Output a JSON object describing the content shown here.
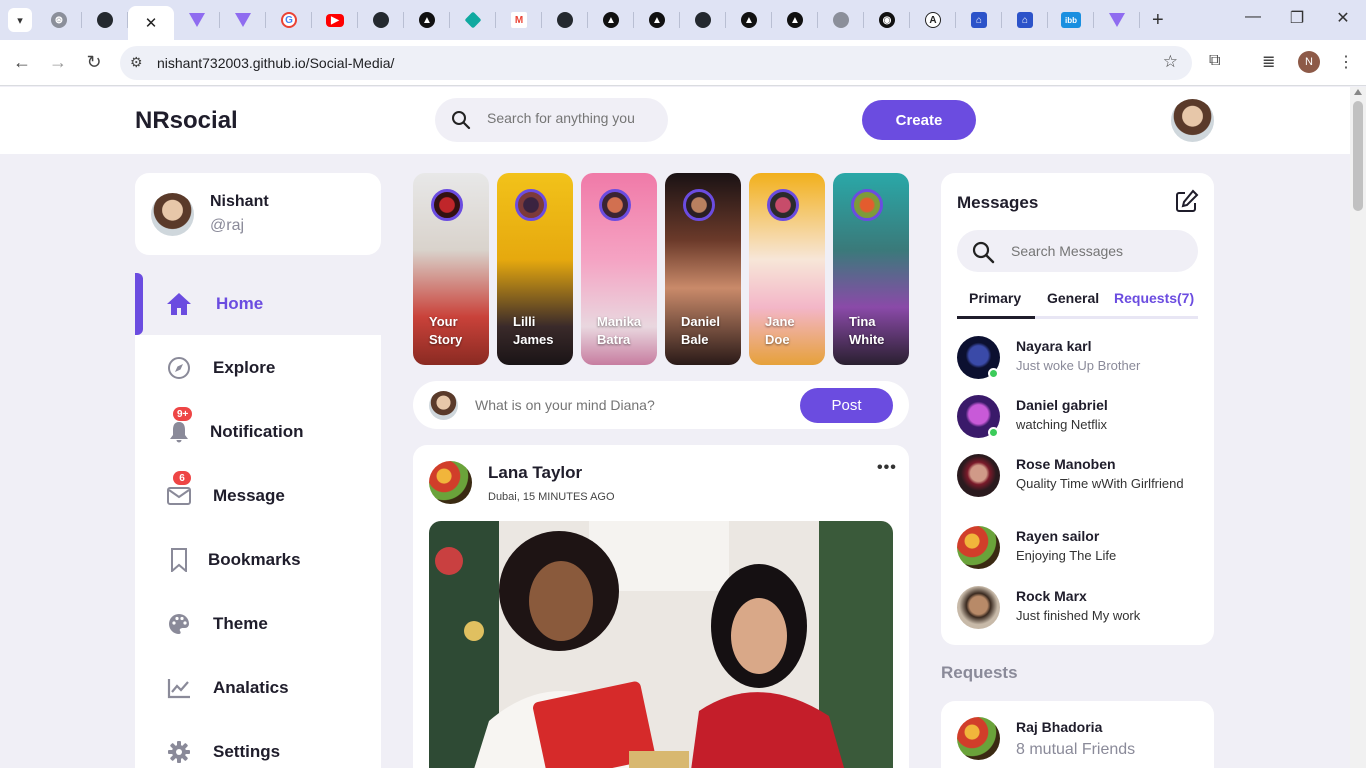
{
  "browser": {
    "active_tab_close": "✕",
    "new_tab": "+",
    "url": "nishant732003.github.io/Social-Media/",
    "profile_initial": "N",
    "tabs": [
      {
        "icon": "openai-icon"
      },
      {
        "icon": "github-icon"
      },
      {
        "icon": "active-tab"
      },
      {
        "icon": "vercel-v-icon"
      },
      {
        "icon": "vercel-v-icon"
      },
      {
        "icon": "google-icon"
      },
      {
        "icon": "youtube-icon"
      },
      {
        "icon": "github-icon"
      },
      {
        "icon": "triangle-icon"
      },
      {
        "icon": "diamond-icon"
      },
      {
        "icon": "gmail-icon"
      },
      {
        "icon": "github-icon"
      },
      {
        "icon": "triangle-icon"
      },
      {
        "icon": "triangle-icon"
      },
      {
        "icon": "github-icon"
      },
      {
        "icon": "triangle-icon"
      },
      {
        "icon": "triangle-icon"
      },
      {
        "icon": "globe-icon"
      },
      {
        "icon": "circle-icon"
      },
      {
        "icon": "a-icon"
      },
      {
        "icon": "house-icon"
      },
      {
        "icon": "house-icon"
      },
      {
        "icon": "ibb-icon"
      },
      {
        "icon": "vercel-v-icon"
      }
    ]
  },
  "navbar": {
    "logo": "NRsocial",
    "search_placeholder": "Search for anything you",
    "create_label": "Create"
  },
  "profile": {
    "name": "Nishant",
    "handle": "@raj"
  },
  "sidebar": {
    "items": [
      {
        "label": "Home",
        "icon": "home-icon",
        "active": true
      },
      {
        "label": "Explore",
        "icon": "compass-icon"
      },
      {
        "label": "Notification",
        "icon": "bell-icon",
        "badge": "9+"
      },
      {
        "label": "Message",
        "icon": "envelope-icon",
        "badge": "6"
      },
      {
        "label": "Bookmarks",
        "icon": "bookmark-icon"
      },
      {
        "label": "Theme",
        "icon": "palette-icon"
      },
      {
        "label": "Analatics",
        "icon": "chart-line-icon"
      },
      {
        "label": "Settings",
        "icon": "gear-icon"
      }
    ]
  },
  "stories": [
    {
      "line1": "Your",
      "line2": "Story"
    },
    {
      "line1": "Lilli",
      "line2": "James"
    },
    {
      "line1": "Manika",
      "line2": "Batra"
    },
    {
      "line1": "Daniel",
      "line2": "Bale"
    },
    {
      "line1": "Jane",
      "line2": "Doe"
    },
    {
      "line1": "Tina",
      "line2": "White"
    }
  ],
  "create_post": {
    "placeholder": "What is on your mind Diana?",
    "post_label": "Post"
  },
  "feed": {
    "author": "Lana Taylor",
    "location": "Dubai, 15 MINUTES AGO",
    "more": "•••"
  },
  "messages": {
    "title": "Messages",
    "search_placeholder": "Search Messages",
    "tabs": {
      "primary": "Primary",
      "general": "General",
      "requests": "Requests(7)"
    },
    "items": [
      {
        "name": "Nayara karl",
        "text": "Just woke Up Brother",
        "online": true,
        "muted": true
      },
      {
        "name": "Daniel gabriel",
        "text": "watching Netflix",
        "online": true
      },
      {
        "name": "Rose Manoben",
        "text": "Quality Time wWith Girlfriend"
      },
      {
        "name": "Rayen sailor",
        "text": "Enjoying The Life"
      },
      {
        "name": "Rock Marx",
        "text": "Just finished My work"
      }
    ]
  },
  "requests": {
    "heading": "Requests",
    "name": "Raj Bhadoria",
    "mutual": "8 mutual Friends"
  },
  "colors": {
    "accent": "#6b4ce0",
    "background": "#f0eff6",
    "badge": "#ee4545",
    "online": "#3ccb5a"
  }
}
